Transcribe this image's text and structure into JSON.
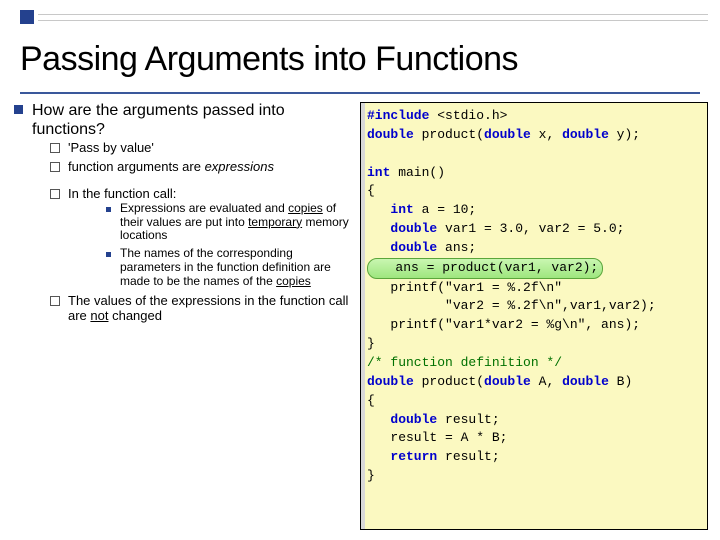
{
  "title": "Passing Arguments into Functions",
  "left": {
    "q": "How are the arguments passed into functions?",
    "a1": "'Pass by value'",
    "a2_pre": "function arguments are ",
    "a2_em": "expressions",
    "call_intro": "In the function call:",
    "eval_pre": "Expressions are evaluated and ",
    "eval_u1": "copies",
    "eval_mid": " of their values are put into ",
    "eval_u2": "temporary",
    "eval_post": " memory locations",
    "names_pre": "The names of the corresponding parameters in the function definition are made to be the names of the ",
    "names_u": "copies",
    "notchg_pre": "The values of the expressions in the function call are ",
    "notchg_u": "not",
    "notchg_post": " changed"
  },
  "code": {
    "l01a": "#include",
    "l01b": " <stdio.h>",
    "l02a": "double",
    "l02b": " product(",
    "l02c": "double",
    "l02d": " x, ",
    "l02e": "double",
    "l02f": " y);",
    "l03": "",
    "l04a": "int",
    "l04b": " main()",
    "l05": "{",
    "l06a": "   int",
    "l06b": " a = 10;",
    "l07a": "   double",
    "l07b": " var1 = 3.0, var2 = 5.0;",
    "l08a": "   double",
    "l08b": " ans;",
    "l09": "   ans = product(var1, var2);",
    "l10": "   printf(\"var1 = %.2f\\n\"",
    "l11": "          \"var2 = %.2f\\n\",var1,var2);",
    "l12": "   printf(\"var1*var2 = %g\\n\", ans);",
    "l13": "}",
    "l14": "/* function definition */",
    "l15a": "double",
    "l15b": " product(",
    "l15c": "double",
    "l15d": " A, ",
    "l15e": "double",
    "l15f": " B)",
    "l16": "{",
    "l17a": "   double",
    "l17b": " result;",
    "l18": "   result = A * B;",
    "l19a": "   return",
    "l19b": " result;",
    "l20": "}"
  }
}
